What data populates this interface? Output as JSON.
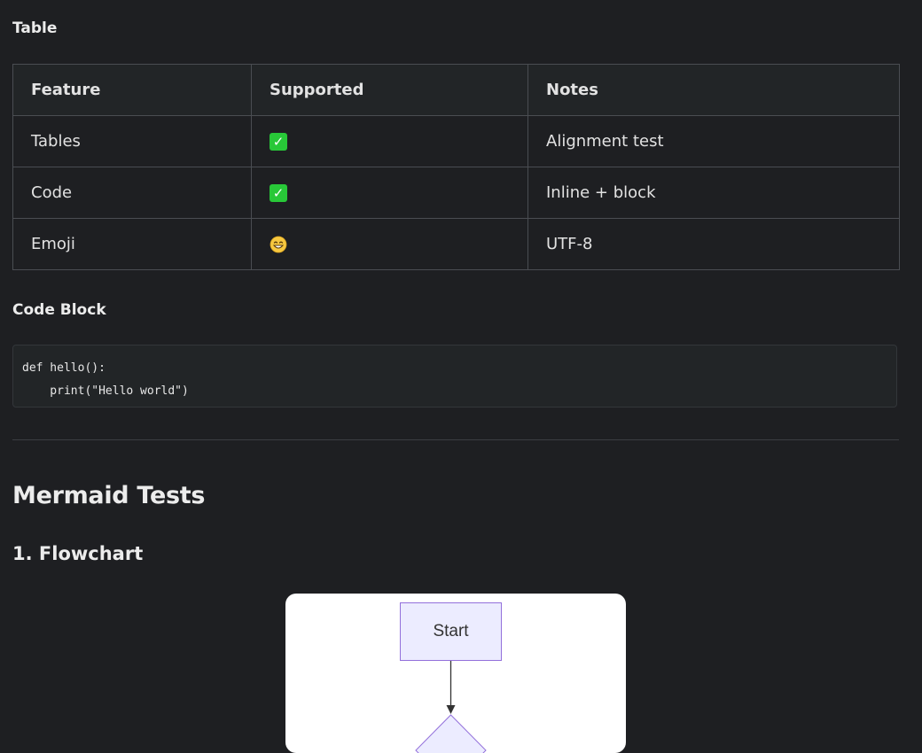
{
  "sections": {
    "table_heading": "Table",
    "code_heading": "Code Block",
    "mermaid_heading": "Mermaid Tests",
    "flowchart_heading": "1. Flowchart"
  },
  "table": {
    "headers": [
      "Feature",
      "Supported",
      "Notes"
    ],
    "rows": [
      {
        "feature": "Tables",
        "supported": "check",
        "notes": "Alignment test"
      },
      {
        "feature": "Code",
        "supported": "check",
        "notes": "Inline + block"
      },
      {
        "feature": "Emoji",
        "supported": "grin",
        "notes": "UTF-8"
      }
    ]
  },
  "code": {
    "line1": "def hello():",
    "line2": "    print(\"Hello world\")"
  },
  "flowchart": {
    "start_label": "Start"
  },
  "colors": {
    "background": "#1e1f22",
    "node_fill": "#ececff",
    "node_stroke": "#9370db",
    "check_green": "#28c838"
  }
}
